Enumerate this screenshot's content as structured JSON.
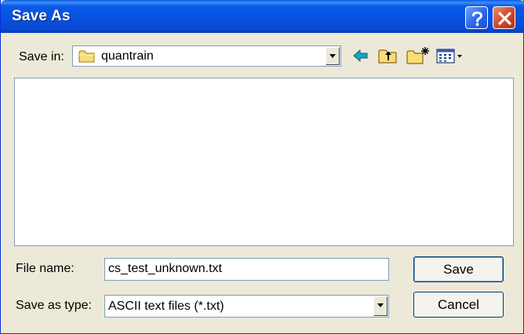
{
  "window": {
    "title": "Save As"
  },
  "titlebar": {
    "help_icon": "help-icon",
    "close_icon": "close-icon"
  },
  "location": {
    "label": "Save in:",
    "folder_icon": "folder-icon",
    "value": "quantrain"
  },
  "toolbar": {
    "icons": [
      "back-arrow-icon",
      "up-folder-icon",
      "new-folder-icon",
      "view-menu-icon"
    ]
  },
  "file_list": {
    "items": []
  },
  "filename": {
    "label": "File name:",
    "value": "cs_test_unknown.txt"
  },
  "filetype": {
    "label": "Save as type:",
    "value": "ASCII text files (*.txt)"
  },
  "buttons": {
    "save": "Save",
    "cancel": "Cancel"
  },
  "colors": {
    "titlebar": "#0a5ae8",
    "dialog_bg": "#ece9d8",
    "field_border": "#7f9db9",
    "close_red": "#d1452a"
  }
}
